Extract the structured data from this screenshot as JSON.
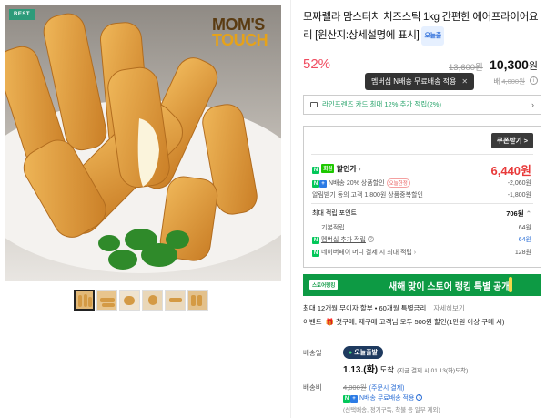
{
  "image": {
    "badge": "BEST",
    "brand_line1": "MOM'S",
    "brand_line2": "TOUCH",
    "thumbnails": [
      "thumb-1",
      "thumb-2",
      "thumb-3",
      "thumb-4",
      "thumb-5",
      "thumb-6"
    ]
  },
  "product": {
    "title": "모짜렐라 맘스터치 치즈스틱 1kg 간편한 에어프라이어요리 [원산지:상세설명에 표시]",
    "today_badge": "오늘출",
    "discount": "52%",
    "original_price": "13,600원",
    "sale_price": "10,300",
    "sale_unit": "원"
  },
  "shipping_tooltip": {
    "text": "멤버십 N배송 무료배송 적용",
    "close": "✕"
  },
  "shipping_fee": {
    "label": "배",
    "struck": "4,000원"
  },
  "card_promo": "라인프렌즈 카드 최대 12% 추가 적립(2%)",
  "benefits": {
    "coupon_button": "쿠폰받기 >",
    "discount_label": "할인가",
    "discount_price": "6,440원",
    "n_discount": "N배송 20% 상품할인",
    "limited": "오늘한정",
    "n_discount_value": "-2,060원",
    "first_buy": "알림받기 동의 고객 1,800원 상품중복할인",
    "first_buy_value": "-1,800원",
    "points_label": "최대 적립 포인트",
    "points_total": "706원",
    "basic_points": "기본적립",
    "basic_points_value": "64원",
    "membership_points": "멤버십 추가 적립",
    "membership_points_value": "64원",
    "naverpay_points": "네이버페이 머니 결제 시 최대 적립",
    "naverpay_points_value": "128원"
  },
  "banner": {
    "logo": "스토어랭킹",
    "text": "새해 맞이 스토어 랭킹 특별 공개"
  },
  "promo": {
    "line1": "최대 12개월 무이자 할부 • 60개월 특별금리",
    "line1_more": "자세히보기",
    "line2_label": "이벤트",
    "line2": "첫구매, 재구매 고객님 모두 500원 할인(1만원 이상 구매 시)"
  },
  "delivery": {
    "label": "배송일",
    "pill": "오늘출발",
    "date": "1.13.(화)",
    "arrive_word": "도착",
    "arrive_note": "(지금 결제 시 01.13(화)도착)",
    "fee_label": "배송비",
    "fee_struck": "4,000원",
    "fee_note": "(주문시 결제)",
    "free": "N배송 무료배송 적용",
    "extra": "(선택배송, 정기구독, 착불 등 일부 제외)"
  }
}
